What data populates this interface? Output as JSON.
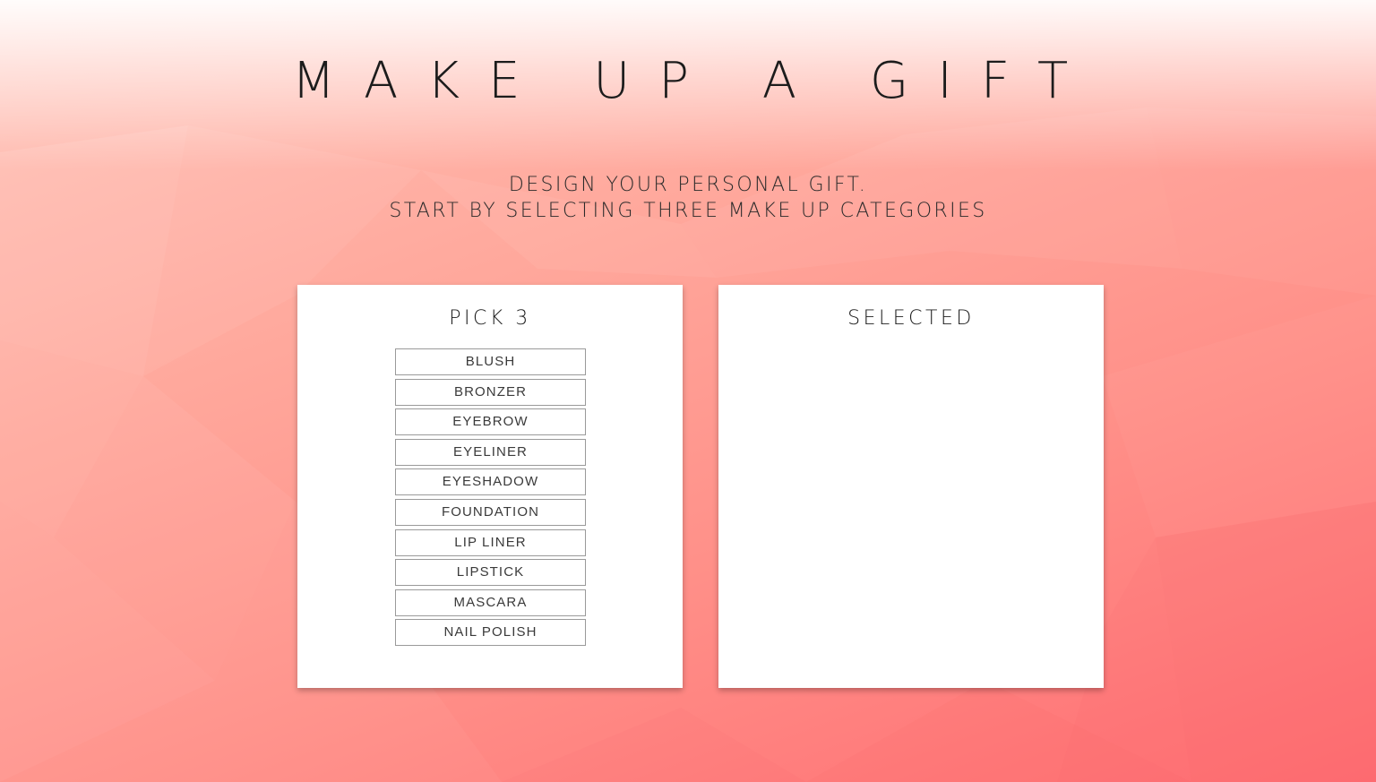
{
  "header": {
    "title": "MAKE UP A GIFT",
    "subtitle_line1": "DESIGN YOUR PERSONAL GIFT.",
    "subtitle_line2": "START BY SELECTING THREE MAKE UP CATEGORIES"
  },
  "pick_panel": {
    "title": "PICK 3",
    "categories": [
      {
        "label": "BLUSH"
      },
      {
        "label": "BRONZER"
      },
      {
        "label": "EYEBROW"
      },
      {
        "label": "EYELINER"
      },
      {
        "label": "EYESHADOW"
      },
      {
        "label": "FOUNDATION"
      },
      {
        "label": "LIP LINER"
      },
      {
        "label": "LIPSTICK"
      },
      {
        "label": "MASCARA"
      },
      {
        "label": "NAIL POLISH"
      }
    ]
  },
  "selected_panel": {
    "title": "SELECTED",
    "items": []
  },
  "colors": {
    "background_light": "#ffc3b8",
    "background_dark": "#ff6d72",
    "panel": "#ffffff",
    "button_border": "#9a9a9a",
    "text": "#1c1c1c"
  }
}
